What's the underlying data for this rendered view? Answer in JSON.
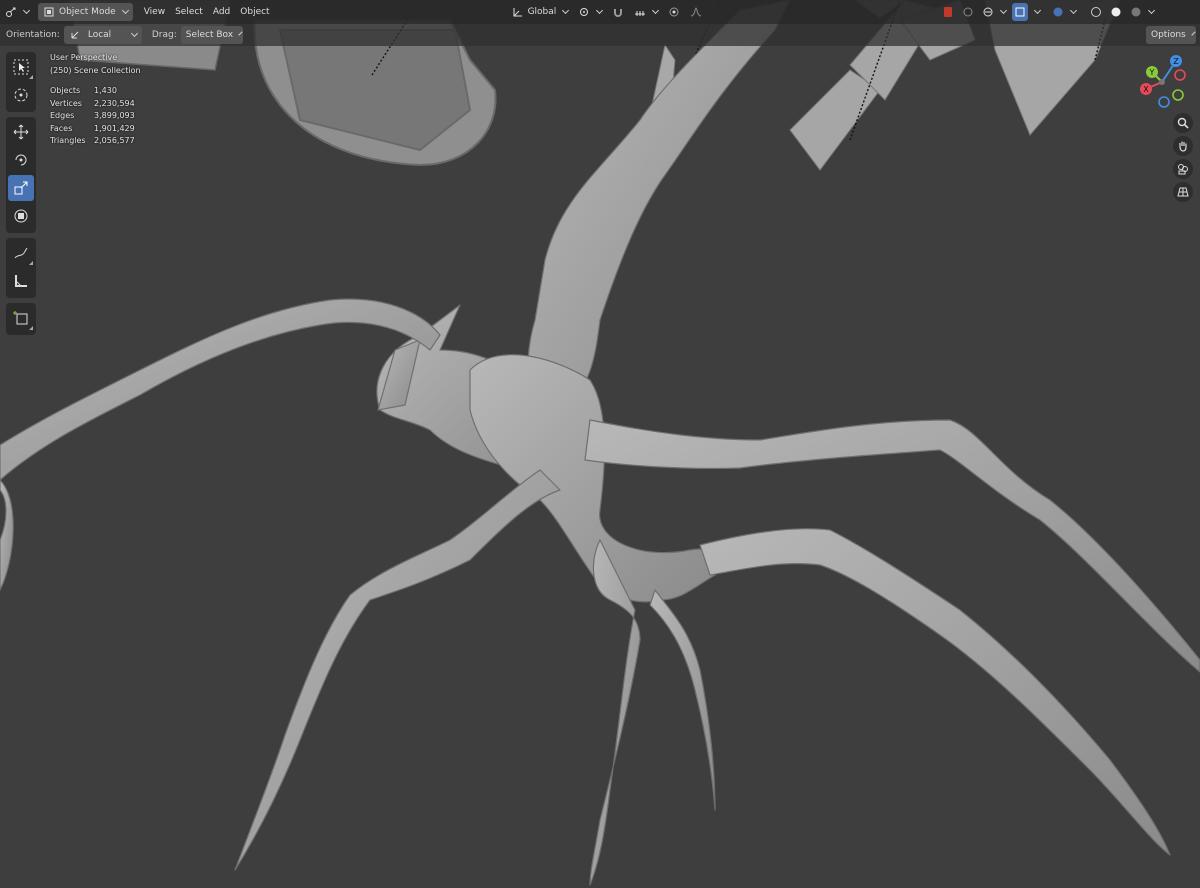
{
  "header": {
    "editor_type_icon": "3d-viewport-icon",
    "mode": {
      "icon": "object-mode-icon",
      "label": "Object Mode"
    },
    "menus": [
      "View",
      "Select",
      "Add",
      "Object"
    ],
    "transform_orientation": {
      "icon": "global-axes-icon",
      "label": "Global"
    },
    "pivot_icon": "pivot-point-icon",
    "snap_icon": "snap-magnet-icon",
    "snap_target_icon": "snap-increment-icon",
    "proportional_icon": "proportional-editing-icon",
    "falloff_icon": "falloff-curve-icon",
    "right_icons": [
      "selectability-icon",
      "gizmo-toggle-icon",
      "overlays-icon",
      "xray-icon",
      "wireframe-shading-icon",
      "solid-shading-icon",
      "material-preview-icon",
      "rendered-shading-icon"
    ]
  },
  "tool_settings": {
    "orientation_label": "Orientation:",
    "orientation_value": "Local",
    "drag_label": "Drag:",
    "drag_value": "Select Box",
    "options_label": "Options"
  },
  "toolbar": {
    "tools": [
      "select-box-icon",
      "cursor-icon",
      "move-icon",
      "rotate-icon",
      "scale-icon",
      "transform-icon",
      "annotate-icon",
      "measure-icon",
      "add-cube-icon"
    ],
    "active": "scale-icon"
  },
  "stats": {
    "view": "User Perspective",
    "collection": "(250) Scene Collection",
    "rows": [
      {
        "k": "Objects",
        "v": "1,430"
      },
      {
        "k": "Vertices",
        "v": "2,230,594"
      },
      {
        "k": "Edges",
        "v": "3,899,093"
      },
      {
        "k": "Faces",
        "v": "1,901,429"
      },
      {
        "k": "Triangles",
        "v": "2,056,577"
      }
    ]
  },
  "gizmo": {
    "z": "Z",
    "y": "Y",
    "x": "X",
    "colors": {
      "x": "#e8495a",
      "y": "#8ac93a",
      "z": "#3f8fe6"
    },
    "nav_buttons": [
      "zoom-icon",
      "pan-hand-icon",
      "camera-icon",
      "grid-perspective-icon"
    ]
  },
  "colors": {
    "bg": "#3e3e3e",
    "header": "#282828",
    "accent": "#4772b3",
    "mesh": "#9a9a9a"
  }
}
